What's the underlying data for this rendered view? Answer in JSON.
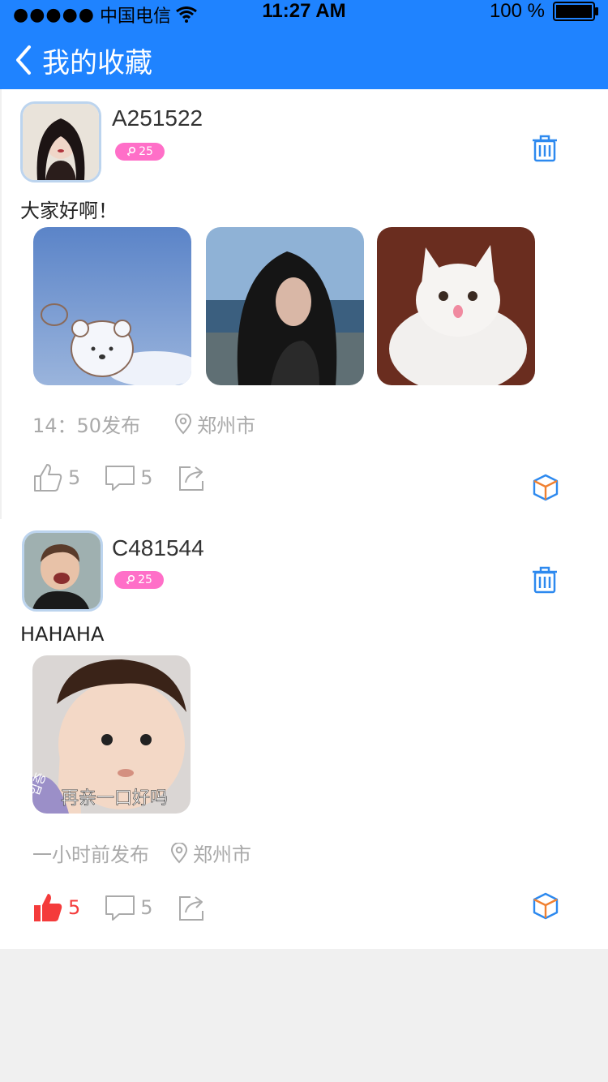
{
  "status_bar": {
    "signal_dots": "●●●●●",
    "carrier": "中国电信",
    "time": "11:27 AM",
    "battery": "100 %"
  },
  "header": {
    "title": "我的收藏"
  },
  "posts": [
    {
      "username": "A251522",
      "badge_count": "25",
      "text": "大家好啊！",
      "time": "14：50发布",
      "location": "郑州市",
      "likes": "5",
      "comments": "5",
      "liked": false,
      "photos": [
        "bear-cloud-photo",
        "girl-beach-photo",
        "white-cat-photo"
      ]
    },
    {
      "username": "C481544",
      "badge_count": "25",
      "text": "HAHAHA",
      "time": "一小时前发布",
      "location": "郑州市",
      "likes": "5",
      "comments": "5",
      "liked": true,
      "photos": [
        "baby-meme-photo"
      ],
      "photo_caption": "再亲一口好吗"
    }
  ],
  "colors": {
    "brand": "#1f83ff",
    "like": "#f43b3b",
    "badge": "#ff6fc8"
  }
}
